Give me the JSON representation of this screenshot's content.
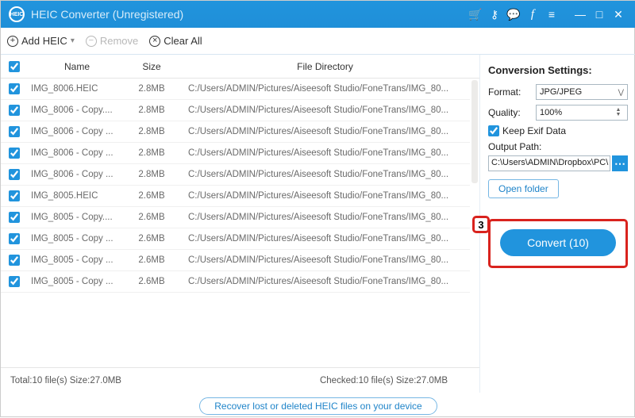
{
  "title": "HEIC Converter (Unregistered)",
  "toolbar": {
    "addHeic": "Add HEIC",
    "remove": "Remove",
    "clearAll": "Clear All"
  },
  "columns": {
    "name": "Name",
    "size": "Size",
    "dir": "File Directory"
  },
  "rows": [
    {
      "checked": true,
      "name": "IMG_8006.HEIC",
      "size": "2.8MB",
      "dir": "C:/Users/ADMIN/Pictures/Aiseesoft Studio/FoneTrans/IMG_80..."
    },
    {
      "checked": true,
      "name": "IMG_8006 - Copy....",
      "size": "2.8MB",
      "dir": "C:/Users/ADMIN/Pictures/Aiseesoft Studio/FoneTrans/IMG_80..."
    },
    {
      "checked": true,
      "name": "IMG_8006 - Copy ...",
      "size": "2.8MB",
      "dir": "C:/Users/ADMIN/Pictures/Aiseesoft Studio/FoneTrans/IMG_80..."
    },
    {
      "checked": true,
      "name": "IMG_8006 - Copy ...",
      "size": "2.8MB",
      "dir": "C:/Users/ADMIN/Pictures/Aiseesoft Studio/FoneTrans/IMG_80..."
    },
    {
      "checked": true,
      "name": "IMG_8006 - Copy ...",
      "size": "2.8MB",
      "dir": "C:/Users/ADMIN/Pictures/Aiseesoft Studio/FoneTrans/IMG_80..."
    },
    {
      "checked": true,
      "name": "IMG_8005.HEIC",
      "size": "2.6MB",
      "dir": "C:/Users/ADMIN/Pictures/Aiseesoft Studio/FoneTrans/IMG_80..."
    },
    {
      "checked": true,
      "name": "IMG_8005 - Copy....",
      "size": "2.6MB",
      "dir": "C:/Users/ADMIN/Pictures/Aiseesoft Studio/FoneTrans/IMG_80..."
    },
    {
      "checked": true,
      "name": "IMG_8005 - Copy ...",
      "size": "2.6MB",
      "dir": "C:/Users/ADMIN/Pictures/Aiseesoft Studio/FoneTrans/IMG_80..."
    },
    {
      "checked": true,
      "name": "IMG_8005 - Copy ...",
      "size": "2.6MB",
      "dir": "C:/Users/ADMIN/Pictures/Aiseesoft Studio/FoneTrans/IMG_80..."
    },
    {
      "checked": true,
      "name": "IMG_8005 - Copy ...",
      "size": "2.6MB",
      "dir": "C:/Users/ADMIN/Pictures/Aiseesoft Studio/FoneTrans/IMG_80..."
    }
  ],
  "status": {
    "total": "Total:10 file(s) Size:27.0MB",
    "checked": "Checked:10 file(s) Size:27.0MB"
  },
  "settings": {
    "title": "Conversion Settings:",
    "formatLabel": "Format:",
    "formatValue": "JPG/JPEG",
    "qualityLabel": "Quality:",
    "qualityValue": "100%",
    "keepExif": "Keep Exif Data",
    "outputPathLabel": "Output Path:",
    "outputPath": "C:\\Users\\ADMIN\\Dropbox\\PC\\",
    "openFolder": "Open folder",
    "convert": "Convert (10)"
  },
  "annotation": {
    "step": "3"
  },
  "recover": "Recover lost or deleted HEIC files on your device"
}
